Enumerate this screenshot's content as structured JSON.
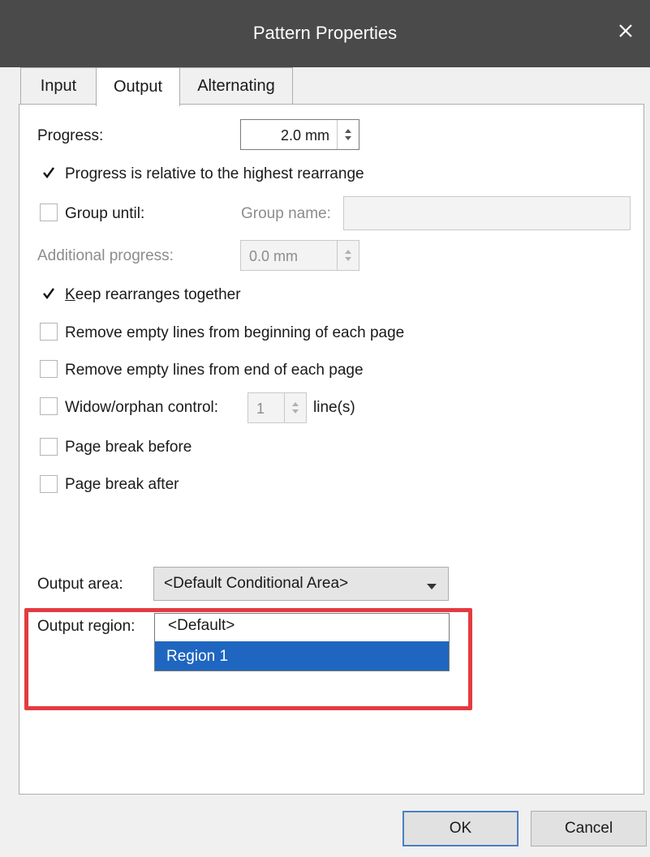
{
  "window": {
    "title": "Pattern Properties",
    "close_icon": "close-icon"
  },
  "tabs": [
    {
      "label": "Input",
      "active": false
    },
    {
      "label": "Output",
      "active": true
    },
    {
      "label": "Alternating",
      "active": false
    }
  ],
  "progress": {
    "label": "Progress:",
    "value": "2.0 mm"
  },
  "options": {
    "relative_highest": {
      "label": "Progress is relative to the highest rearrange",
      "checked": true
    },
    "group_until": {
      "label": "Group until:",
      "checked": false
    },
    "group_name_label": "Group name:",
    "group_name_value": "",
    "additional_progress_label": "Additional progress:",
    "additional_progress_value": "0.0 mm",
    "keep_together": {
      "label_first": "K",
      "label_rest": "eep rearranges together",
      "checked": true
    },
    "remove_begin": {
      "label": "Remove empty lines from beginning of each page",
      "checked": false
    },
    "remove_end": {
      "label": "Remove empty lines from end of each page",
      "checked": false
    },
    "widow_orphan": {
      "label": "Widow/orphan control:",
      "checked": false,
      "value": "1",
      "unit": "line(s)"
    },
    "page_break_before": {
      "label": "Page break before",
      "checked": false
    },
    "page_break_after": {
      "label": "Page break after",
      "checked": false
    }
  },
  "output_area": {
    "label": "Output area:",
    "value": "<Default Conditional Area>"
  },
  "output_region": {
    "label": "Output region:",
    "options": [
      "<Default>",
      "Region 1"
    ],
    "selected": "Region 1"
  },
  "buttons": {
    "ok": "OK",
    "cancel": "Cancel"
  },
  "colors": {
    "titlebar": "#4a4a4a",
    "selection": "#1e66c0",
    "annotation": "#e33b41"
  }
}
